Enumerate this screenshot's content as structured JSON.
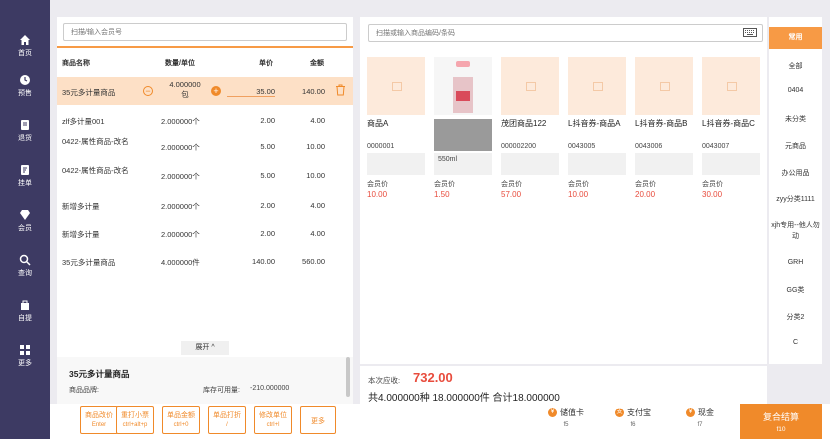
{
  "sidebar": {
    "items": [
      {
        "label": "首页",
        "icon": "home-icon"
      },
      {
        "label": "预售",
        "icon": "clock-icon"
      },
      {
        "label": "退货",
        "icon": "return-icon"
      },
      {
        "label": "挂单",
        "icon": "hold-order-icon"
      },
      {
        "label": "会员",
        "icon": "member-icon"
      },
      {
        "label": "查询",
        "icon": "query-icon"
      },
      {
        "label": "自提",
        "icon": "pickup-icon"
      },
      {
        "label": "更多",
        "icon": "more-icon"
      }
    ]
  },
  "member_search": {
    "placeholder": "扫描/输入会员号"
  },
  "cart": {
    "headers": {
      "name": "商品名称",
      "qty": "数量/单位",
      "price": "单价",
      "amount": "金额"
    },
    "rows": [
      {
        "name": "35元多计量商品",
        "qty": "4.000000",
        "unit": "包",
        "price": "35.00",
        "amount": "140.00",
        "selected": true
      },
      {
        "name": "zlf多计量001",
        "qty": "2.000000个",
        "price": "2.00",
        "amount": "4.00"
      },
      {
        "name": "0422-属性商品-改名",
        "qty": "2.000000个",
        "price": "5.00",
        "amount": "10.00"
      },
      {
        "name": "0422-属性商品-改名",
        "qty": "2.000000个",
        "price": "5.00",
        "amount": "10.00"
      },
      {
        "name": "新增多计量",
        "qty": "2.000000个",
        "price": "2.00",
        "amount": "4.00"
      },
      {
        "name": "新增多计量",
        "qty": "2.000000个",
        "price": "2.00",
        "amount": "4.00"
      },
      {
        "name": "35元多计量商品",
        "qty": "4.000000件",
        "price": "140.00",
        "amount": "560.00"
      }
    ]
  },
  "detail": {
    "expand_label": "展开 ^",
    "title": "35元多计量商品",
    "brand_label": "商品品牌:",
    "stock_label": "库存可用量:",
    "stock_value": "-210.000000"
  },
  "actions": [
    {
      "label": "商品改价",
      "key": "Enter"
    },
    {
      "label": "重打小票",
      "key": "ctrl+alt+p"
    },
    {
      "label": "单品金额",
      "key": "ctrl+0"
    },
    {
      "label": "单品打折",
      "key": "/"
    },
    {
      "label": "修改单位",
      "key": "ctrl+l"
    },
    {
      "label": "更多",
      "key": ""
    }
  ],
  "product_search": {
    "placeholder": "扫描或输入商品编码/条码"
  },
  "products": [
    {
      "name": "商品A",
      "code": "0000001",
      "member_label": "会员价",
      "price": "10.00",
      "extra": ""
    },
    {
      "name": "",
      "code": "",
      "member_label": "会员价",
      "price": "1.50",
      "extra": "550ml"
    },
    {
      "name": "茂团商品122",
      "code": "000002200",
      "member_label": "会员价",
      "price": "57.00",
      "extra": ""
    },
    {
      "name": "L抖音券-商品A",
      "code": "0043005",
      "member_label": "会员价",
      "price": "10.00",
      "extra": ""
    },
    {
      "name": "L抖音券-商品B",
      "code": "0043006",
      "member_label": "会员价",
      "price": "20.00",
      "extra": ""
    },
    {
      "name": "L抖音券-商品C",
      "code": "0043007",
      "member_label": "会员价",
      "price": "30.00",
      "extra": ""
    }
  ],
  "categories": [
    "常用",
    "全部",
    "0404",
    "未分类",
    "元商品",
    "办公用品",
    "zyy分类1111",
    "xjh专用--他人勿动",
    "GRH",
    "GG类",
    "分类2",
    "C"
  ],
  "summary": {
    "due_label": "本次应收:",
    "due_value": "732.00",
    "count_text": "共4.000000种 18.000000件 合计18.000000"
  },
  "payments": [
    {
      "label": "储值卡",
      "key": "f5"
    },
    {
      "label": "支付宝",
      "key": "f6"
    },
    {
      "label": "现金",
      "key": "f7"
    }
  ],
  "checkout": {
    "label": "复合结算",
    "key": "f10"
  },
  "colors": {
    "accent": "#f08a2a",
    "sidebar": "#3d3a63",
    "price_red": "#e84c3d",
    "selected_row": "#fde0c6"
  }
}
